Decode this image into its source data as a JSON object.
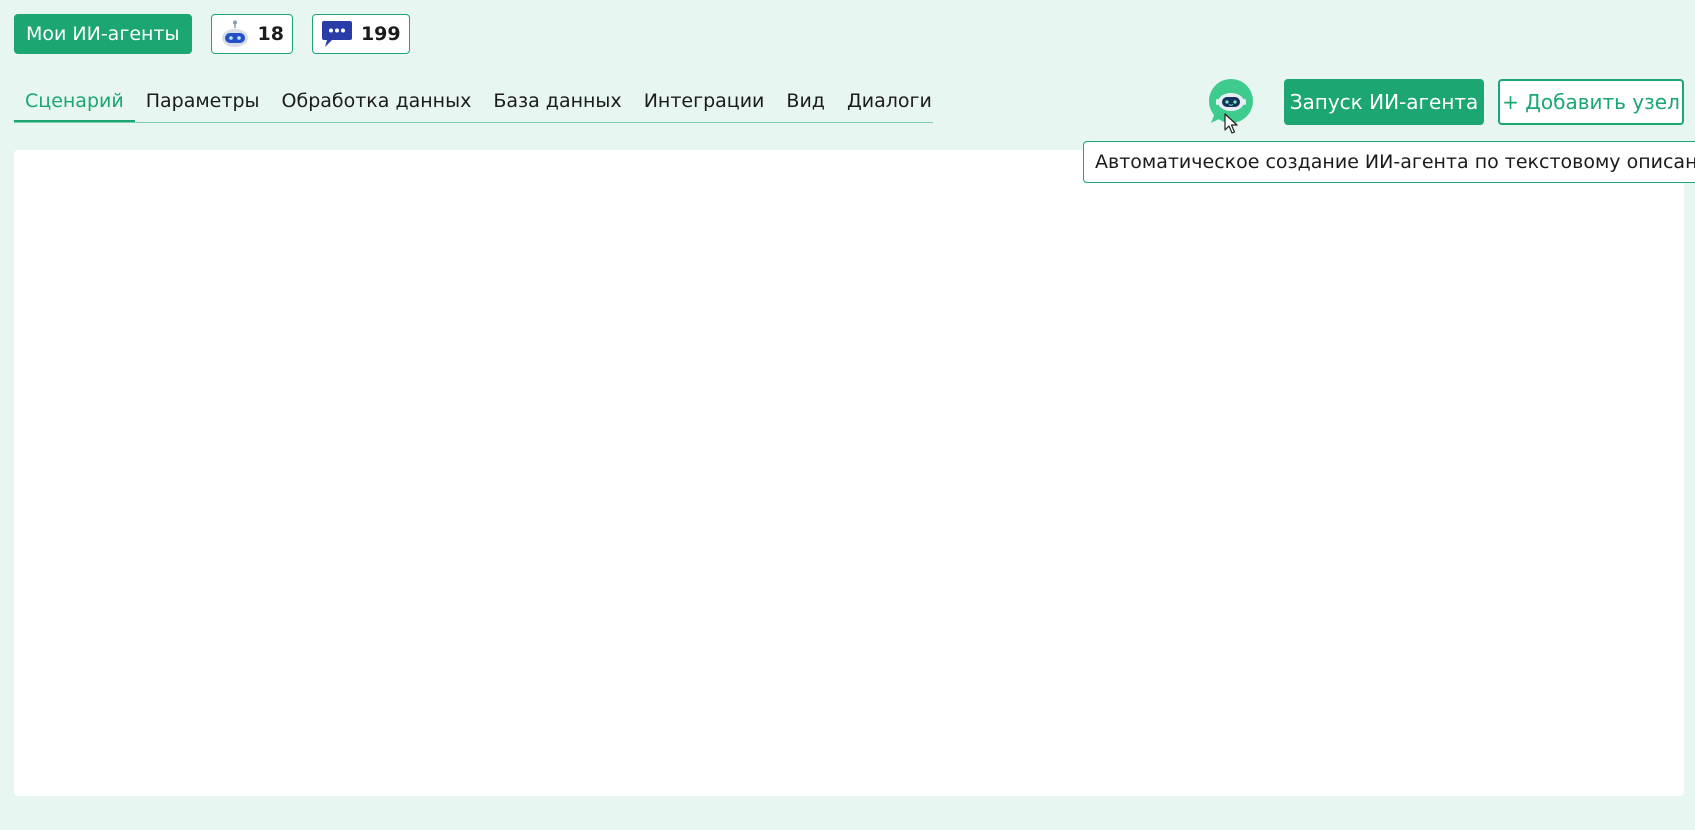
{
  "header": {
    "my_agents_label": "Мои ИИ-агенты",
    "agents_count": "18",
    "messages_count": "199"
  },
  "tabs": [
    {
      "label": "Сценарий",
      "active": true
    },
    {
      "label": "Параметры",
      "active": false
    },
    {
      "label": "Обработка данных",
      "active": false
    },
    {
      "label": "База данных",
      "active": false
    },
    {
      "label": "Интеграции",
      "active": false
    },
    {
      "label": "Вид",
      "active": false
    },
    {
      "label": "Диалоги",
      "active": false
    }
  ],
  "actions": {
    "launch_label": "Запуск ИИ-агента",
    "add_node_label": "+ Добавить узел"
  },
  "tooltip": {
    "text": "Автоматическое создание ИИ-агента по текстовому описанию"
  },
  "icons": {
    "agents_counter": "robot-icon",
    "messages_counter": "chat-bubble-icon",
    "auto_create": "robot-chat-icon",
    "cursor": "mouse-pointer-icon"
  },
  "colors": {
    "accent": "#1ba672",
    "background": "#e7f6f0",
    "canvas": "#ffffff"
  }
}
